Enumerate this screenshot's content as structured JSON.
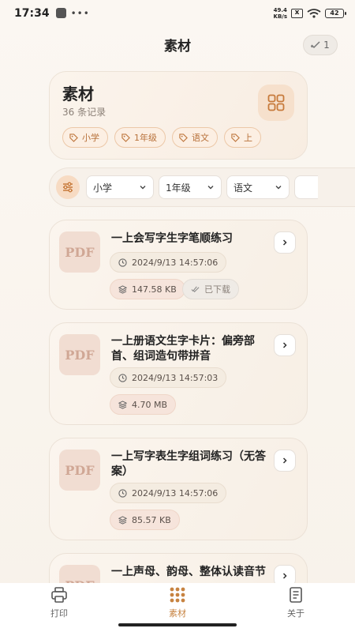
{
  "status_bar": {
    "time": "17:34",
    "net_speed_value": "49.4",
    "net_speed_unit": "KB/s",
    "battery_level": "42"
  },
  "header": {
    "title": "素材",
    "badge_count": "1"
  },
  "summary": {
    "title": "素材",
    "count_text": "36 条记录",
    "tags": [
      "小学",
      "1年级",
      "语文",
      "上"
    ]
  },
  "filters": {
    "selects": [
      "小学",
      "1年级",
      "语文"
    ]
  },
  "materials": [
    {
      "title": "一上会写字生字笔顺练习",
      "thumb": "PDF",
      "date": "2024/9/13 14:57:06",
      "size": "147.58 KB",
      "status": "已下载"
    },
    {
      "title": "一上册语文生字卡片：偏旁部首、组词造句带拼音",
      "thumb": "PDF",
      "date": "2024/9/13 14:57:03",
      "size": "4.70 MB"
    },
    {
      "title": "一上写字表生字组词练习（无答案）",
      "thumb": "PDF",
      "date": "2024/9/13 14:57:06",
      "size": "85.57 KB"
    },
    {
      "title": "一上声母、韵母、整体认读音节",
      "thumb": "PDF"
    }
  ],
  "bottom_nav": {
    "items": [
      {
        "label": "打印"
      },
      {
        "label": "素材"
      },
      {
        "label": "关于"
      }
    ]
  },
  "colors": {
    "accent": "#c78341",
    "tag_text": "#b8713a"
  }
}
